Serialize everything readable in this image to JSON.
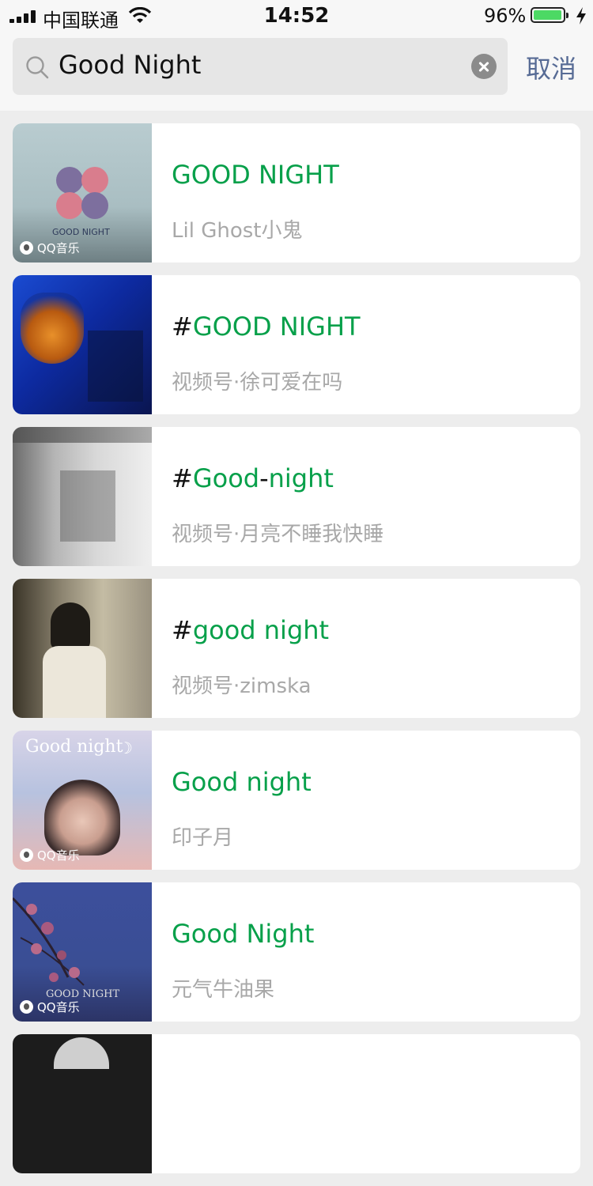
{
  "status_bar": {
    "carrier": "中国联通",
    "time": "14:52",
    "battery_percent": "96%",
    "battery_level": 0.96
  },
  "search": {
    "query": "Good Night",
    "cancel_label": "取消"
  },
  "results": [
    {
      "title_prefix": "",
      "title": "GOOD NIGHT",
      "subtitle": "Lil Ghost小鬼",
      "badge": "QQ音乐",
      "cover_text": "GOOD NIGHT"
    },
    {
      "title_prefix": "#",
      "title": "GOOD NIGHT",
      "subtitle": "视频号·徐可爱在吗"
    },
    {
      "title_prefix": "#",
      "title_part1": "Good",
      "title_sep": "-",
      "title_part2": "night",
      "subtitle": "视频号·月亮不睡我快睡"
    },
    {
      "title_prefix": "#",
      "title": "good night",
      "subtitle": "视频号·zimska"
    },
    {
      "title_prefix": "",
      "title": "Good night",
      "subtitle": "印子月",
      "badge": "QQ音乐",
      "cover_text": "Good night"
    },
    {
      "title_prefix": "",
      "title": "Good Night",
      "subtitle": "元气牛油果",
      "badge": "QQ音乐",
      "cover_text": "GOOD NIGHT"
    }
  ],
  "colors": {
    "highlight": "#07a04a",
    "cancel": "#576b95",
    "subtitle": "#a8a8a8",
    "background": "#ededed"
  }
}
